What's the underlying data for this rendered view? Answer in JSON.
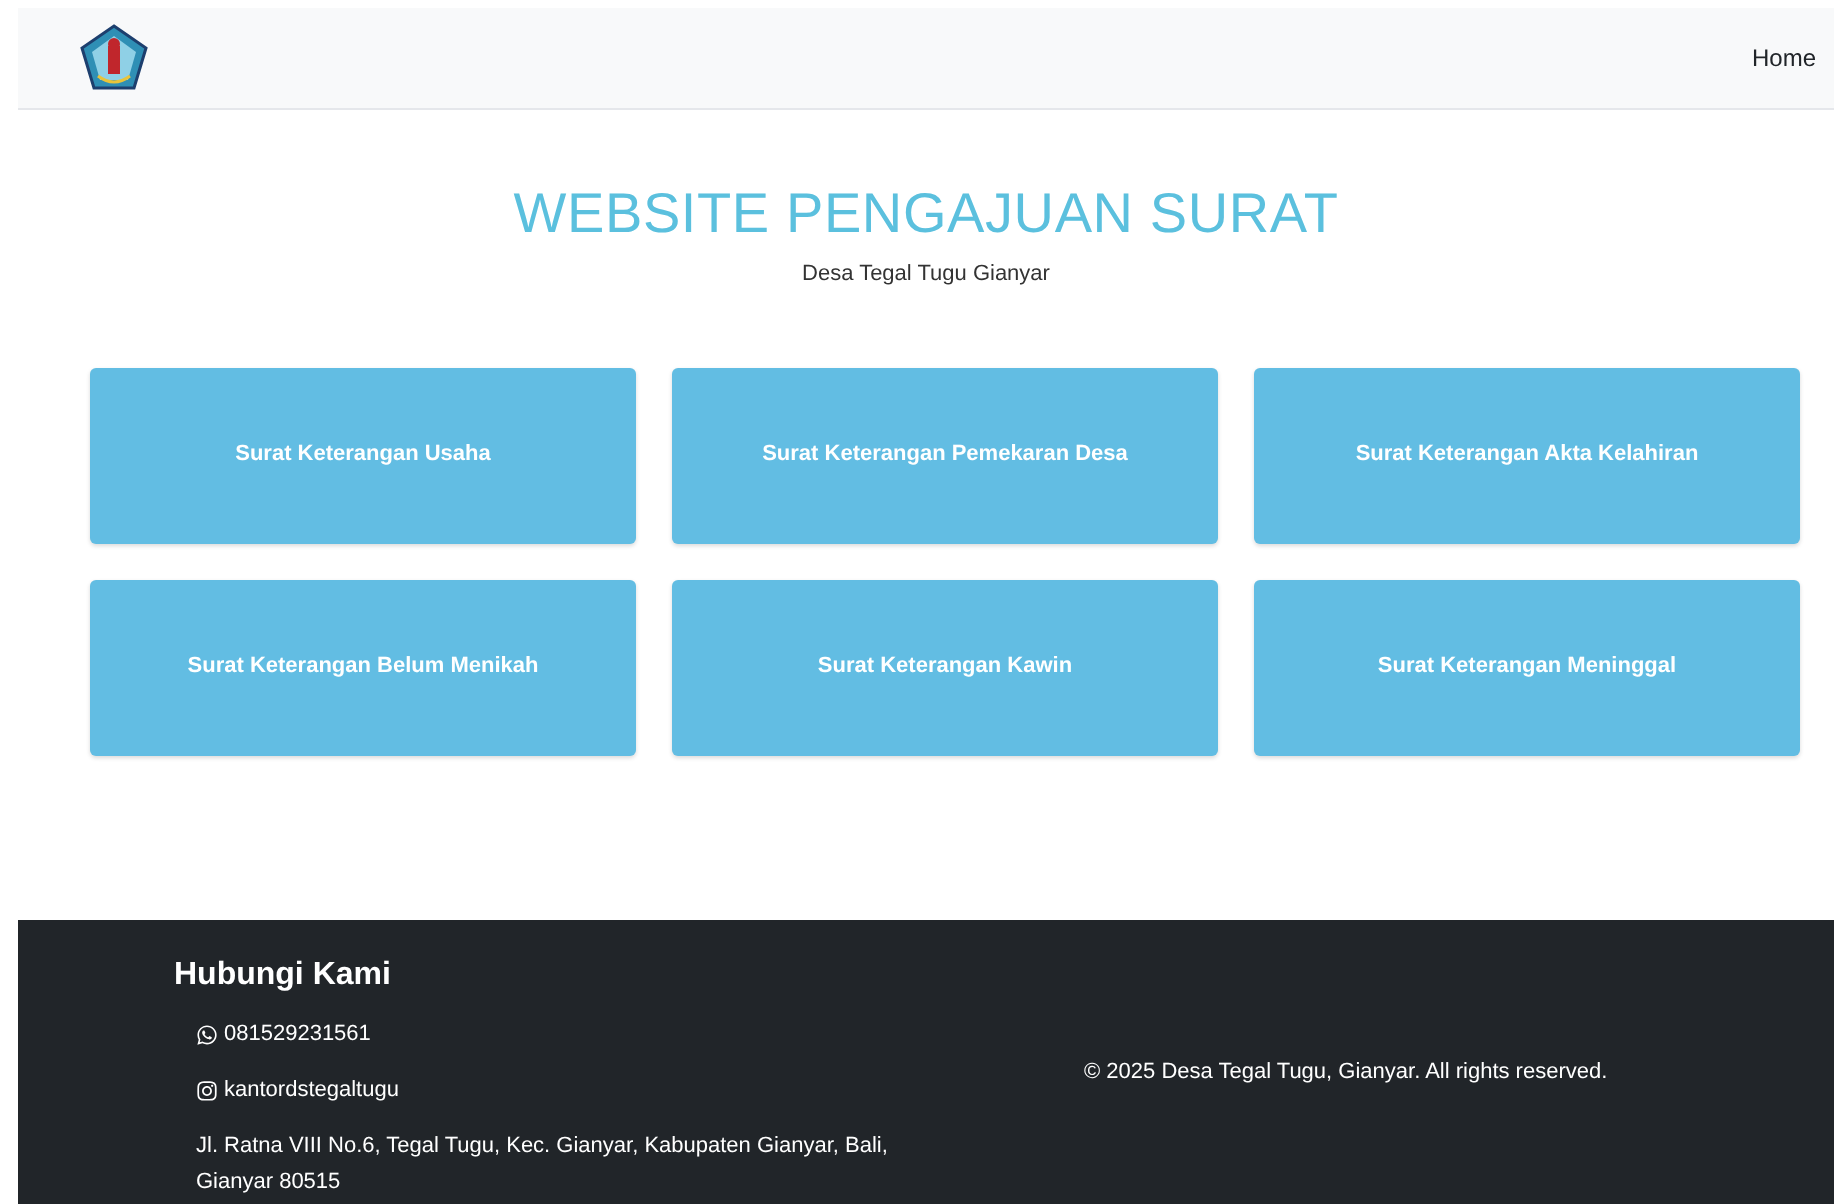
{
  "navbar": {
    "links": [
      {
        "label": "Home"
      }
    ]
  },
  "hero": {
    "title": "WEBSITE PENGAJUAN SURAT",
    "subtitle": "Desa Tegal Tugu Gianyar"
  },
  "services": [
    {
      "label": "Surat Keterangan Usaha"
    },
    {
      "label": "Surat Keterangan Pemekaran Desa"
    },
    {
      "label": "Surat Keterangan Akta Kelahiran"
    },
    {
      "label": "Surat Keterangan Belum Menikah"
    },
    {
      "label": "Surat Keterangan Kawin"
    },
    {
      "label": "Surat Keterangan Meninggal"
    }
  ],
  "footer": {
    "heading": "Hubungi Kami",
    "contacts": [
      {
        "kind": "whatsapp",
        "text": "081529231561"
      },
      {
        "kind": "instagram",
        "text": "kantordstegaltugu"
      },
      {
        "kind": "address",
        "text": "Jl. Ratna VIII No.6, Tegal Tugu, Kec. Gianyar, Kabupaten Gianyar, Bali, Gianyar 80515"
      }
    ],
    "copyright": "© 2025 Desa Tegal Tugu, Gianyar. All rights reserved."
  }
}
